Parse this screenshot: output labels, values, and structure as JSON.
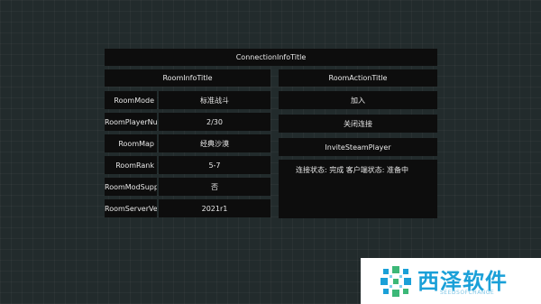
{
  "connection_title": "ConnectionInfoTitle",
  "room_info": {
    "title": "RoomInfoTitle",
    "rows": [
      {
        "label": "RoomMode",
        "value": "标准战斗"
      },
      {
        "label": "RoomPlayerNumber",
        "value": "2/30"
      },
      {
        "label": "RoomMap",
        "value": "经典沙漠"
      },
      {
        "label": "RoomRank",
        "value": "5-7"
      },
      {
        "label": "RoomModSupport",
        "value": "否"
      },
      {
        "label": "RoomServerVersion",
        "value": "2021r1"
      }
    ]
  },
  "room_action": {
    "title": "RoomActionTitle",
    "join_label": "加入",
    "close_label": "关闭连接",
    "invite_label": "InviteSteamPlayer"
  },
  "status": {
    "text": "连接状态:  完成 客户端状态:  准备中"
  },
  "watermark": {
    "title": "西泽软件",
    "subtitle": "SEEDSOFCHANGE",
    "colors": {
      "primary": "#1aa0d8",
      "green": "#3cb878"
    }
  }
}
